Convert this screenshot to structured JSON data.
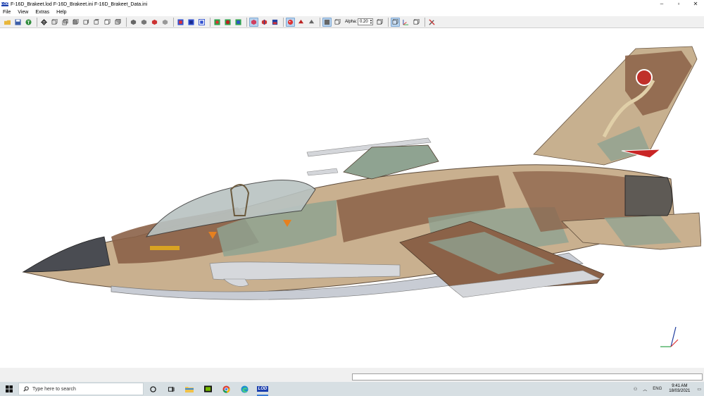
{
  "window": {
    "logo": "LOD",
    "title": "F-16D_Brakeet.lod  F-16D_Brakeet.ini  F-16D_Brakeet_Data.ini",
    "controls": [
      "–",
      "▫",
      "✕"
    ]
  },
  "menu": [
    "File",
    "View",
    "Extras",
    "Help"
  ],
  "toolbar": {
    "alpha_label": "Alpha:",
    "alpha_value": "0.20"
  },
  "taskbar": {
    "search_placeholder": "Type here to search",
    "lang": "ENG",
    "time": "9:41 AM",
    "date": "18/03/2021",
    "active_app_label": "LOD"
  },
  "colors": {
    "accent": "#3b7bd4",
    "camo_tan": "#c9b08f",
    "camo_brown": "#8b6248",
    "camo_green": "#8fa391",
    "belly": "#c8ccd4"
  }
}
